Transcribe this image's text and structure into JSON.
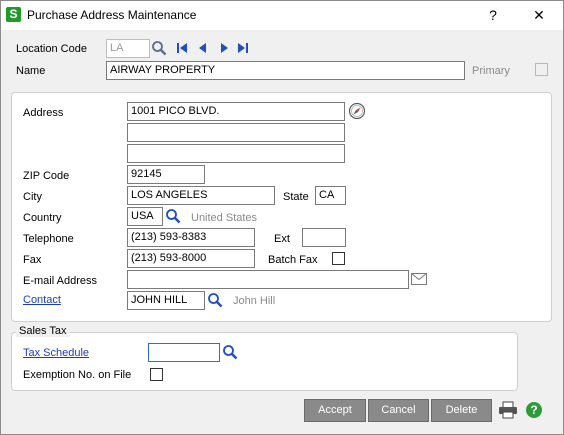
{
  "window": {
    "title": "Purchase Address Maintenance",
    "help_glyph": "?",
    "close_glyph": "✕",
    "app_icon_letter": "S"
  },
  "header": {
    "location_code_label": "Location Code",
    "location_code_value": "LA",
    "name_label": "Name",
    "name_value": "AIRWAY PROPERTY",
    "primary_label": "Primary"
  },
  "address": {
    "address_label": "Address",
    "line1": "1001 PICO BLVD.",
    "line2": "",
    "line3": "",
    "zip_label": "ZIP Code",
    "zip_value": "92145",
    "city_label": "City",
    "city_value": "LOS ANGELES",
    "state_label": "State",
    "state_value": "CA",
    "country_label": "Country",
    "country_value": "USA",
    "country_desc": "United States",
    "telephone_label": "Telephone",
    "telephone_value": "(213) 593-8383",
    "ext_label": "Ext",
    "ext_value": "",
    "fax_label": "Fax",
    "fax_value": "(213) 593-8000",
    "batch_fax_label": "Batch Fax",
    "email_label": "E-mail Address",
    "email_value": "",
    "contact_label": "Contact",
    "contact_value": "JOHN HILL",
    "contact_desc": "John Hill"
  },
  "sales_tax": {
    "group_label": "Sales Tax",
    "tax_schedule_label": "Tax Schedule",
    "tax_schedule_value": "",
    "exemption_label": "Exemption No. on File"
  },
  "buttons": {
    "accept": "Accept",
    "cancel": "Cancel",
    "delete": "Delete"
  },
  "colors": {
    "app_green": "#1f9b2a",
    "link_blue": "#1a3fb5",
    "button_gray": "#8a8a8a",
    "nav_blue": "#1f4fb8"
  }
}
